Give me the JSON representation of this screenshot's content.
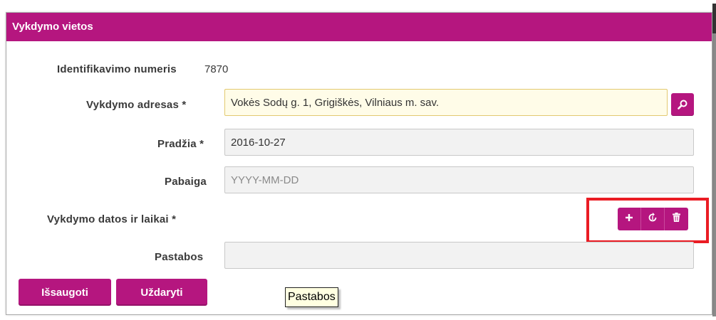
{
  "dialog": {
    "title": "Vykdymo vietos"
  },
  "form": {
    "id_label": "Identifikavimo numeris",
    "id_value": "7870",
    "address_label": "Vykdymo adresas *",
    "address_value": "Vokės Sodų g. 1, Grigiškės, Vilniaus m. sav.",
    "start_label": "Pradžia *",
    "start_value": "2016-10-27",
    "end_label": "Pabaiga",
    "end_placeholder": "YYYY-MM-DD",
    "end_value": "",
    "dates_label": "Vykdymo datos ir laikai *",
    "notes_label": "Pastabos",
    "notes_value": ""
  },
  "icons": {
    "address_search": "search-icon",
    "add": "plus-icon",
    "refresh": "refresh-icon",
    "delete": "trash-icon"
  },
  "buttons": {
    "save": "Išsaugoti",
    "close": "Uždaryti"
  },
  "tooltip": {
    "text": "Pastabos"
  },
  "colors": {
    "accent": "#b5167f",
    "highlight": "#ea1c24",
    "focused_field_bg": "#fffce8"
  }
}
